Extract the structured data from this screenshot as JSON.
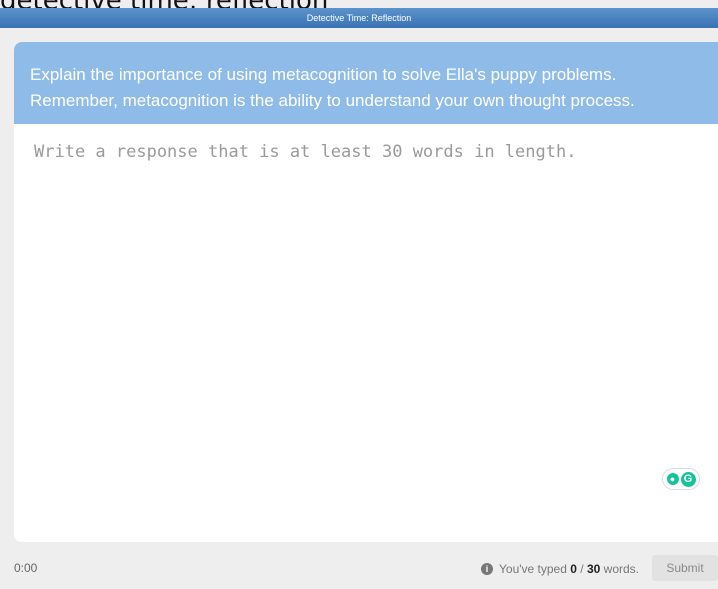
{
  "header": {
    "clipped_text": "detective time: reflection"
  },
  "window": {
    "title": "Detective Time: Reflection"
  },
  "prompt": {
    "text": "Explain the importance of using metacognition to solve Ella's puppy problems. Remember, metacognition is the ability to understand your own thought process."
  },
  "response": {
    "value": "",
    "placeholder": "Write a response that is at least 30 words in length."
  },
  "grammarly": {
    "bulb_icon": "lightbulb-icon",
    "logo_letter": "G"
  },
  "footer": {
    "timer": "0:00",
    "info_icon": "i",
    "typed_prefix": "You've typed ",
    "typed_count": "0",
    "typed_separator": " / ",
    "min_words": "30",
    "typed_suffix": " words.",
    "submit_label": "Submit"
  },
  "colors": {
    "title_bar": "#3a73b5",
    "prompt_bg": "#8fbbe8",
    "grammarly": "#15c39a"
  }
}
